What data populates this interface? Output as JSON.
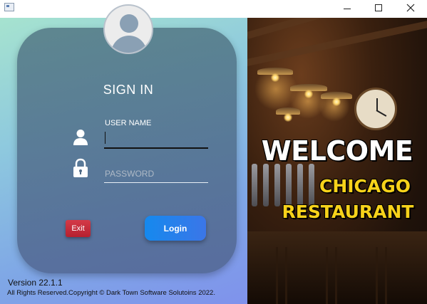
{
  "window": {
    "icons": {
      "app": "app-icon",
      "minimize": "minimize-icon",
      "maximize": "maximize-icon",
      "close": "close-icon"
    }
  },
  "login": {
    "title": "SIGN IN",
    "avatar_icon": "user-avatar-icon",
    "username": {
      "label": "USER NAME",
      "value": "",
      "icon": "user-icon"
    },
    "password": {
      "placeholder": "PASSWORD",
      "value": "",
      "icon": "lock-icon"
    },
    "exit_label": "Exit",
    "login_label": "Login"
  },
  "footer": {
    "version": "Version 22.1.1",
    "copyright": "All Rights Reserved.Copyright © Dark Town Software Solutoins 2022."
  },
  "banner": {
    "line1": "WELCOME",
    "line2": "CHICAGO",
    "line3": "RESTAURANT",
    "line1_color": "#ffffff",
    "line2_color": "#f7d21a"
  },
  "colors": {
    "exit_button": "#c52a38",
    "login_button": "#1f83ec",
    "panel_gradient_start": "#a6e3cf",
    "panel_gradient_end": "#7f92ec"
  }
}
